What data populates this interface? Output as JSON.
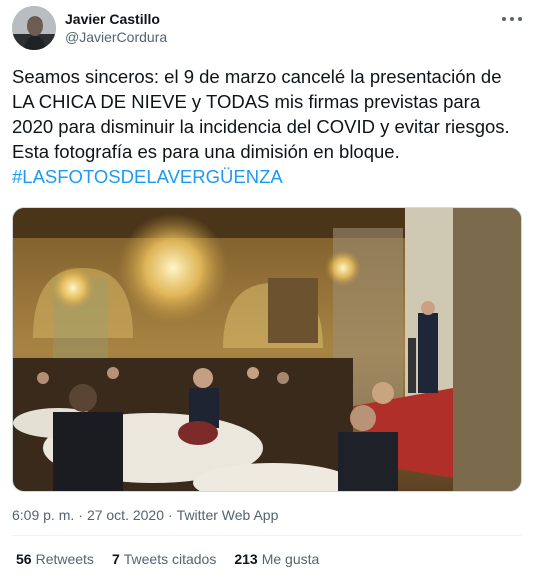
{
  "author": {
    "name": "Javier Castillo",
    "handle": "@JavierCordura"
  },
  "tweet": {
    "text": "Seamos sinceros: el 9 de marzo cancelé la presentación de LA CHICA DE NIEVE y TODAS mis firmas previstas para 2020 para disminuir la incidencia del COVID y evitar riesgos. Esta fotografía es para una dimisión en bloque. ",
    "hashtag": "#LASFOTOSDELAVERGÜENZA"
  },
  "meta": {
    "time": "6:09 p. m.",
    "separator": "·",
    "date": "27 oct. 2020",
    "source": "Twitter Web App"
  },
  "stats": {
    "retweets_count": "56",
    "retweets_label": "Retweets",
    "quotes_count": "7",
    "quotes_label": "Tweets citados",
    "likes_count": "213",
    "likes_label": "Me gusta"
  },
  "icons": {
    "more": "more-horizontal-icon"
  },
  "colors": {
    "link": "#1d9bf0",
    "secondary_text": "#536471",
    "primary_text": "#0f1419"
  }
}
